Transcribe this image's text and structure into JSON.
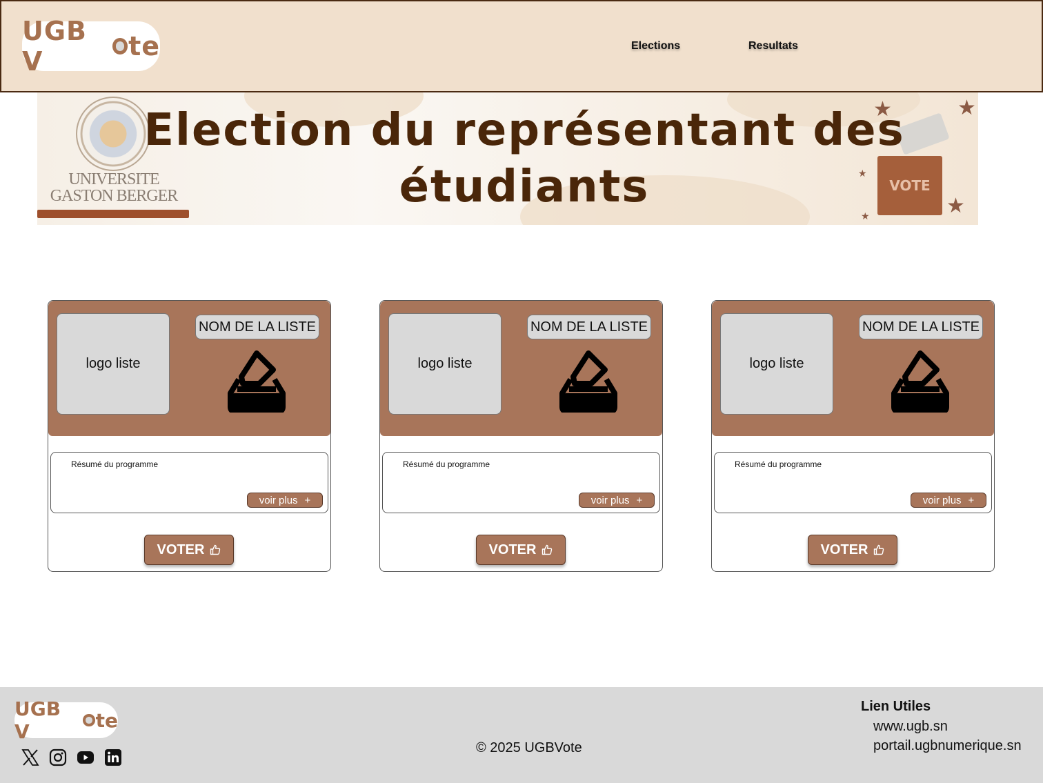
{
  "header": {
    "logo_prefix": "UGB V",
    "logo_suffix": "te",
    "nav": [
      "Elections",
      "Resultats"
    ]
  },
  "banner": {
    "title_line1": "Election du représentant des",
    "title_line2": "étudiants",
    "university_line1": "UNIVERSITE",
    "university_line2": "GASTON BERGER",
    "ballot_box_label": "VOTE"
  },
  "cards": [
    {
      "logo": "logo liste",
      "name": "NOM DE LA LISTE",
      "summary": "Résumé du programme",
      "more": "voir plus",
      "vote": "VOTER"
    },
    {
      "logo": "logo liste",
      "name": "NOM DE LA LISTE",
      "summary": "Résumé du programme",
      "more": "voir plus",
      "vote": "VOTER"
    },
    {
      "logo": "logo liste",
      "name": "NOM DE LA LISTE",
      "summary": "Résumé du programme",
      "more": "voir plus",
      "vote": "VOTER"
    }
  ],
  "footer": {
    "logo_prefix": "UGB V",
    "logo_suffix": "te",
    "social_icons": [
      "x-icon",
      "instagram-icon",
      "youtube-icon",
      "linkedin-icon"
    ],
    "copyright": "© 2025 UGBVote",
    "links_title": "Lien Utiles",
    "links": [
      "www.ugb.sn",
      "portail.ugbnumerique.sn"
    ]
  },
  "colors": {
    "header_bg": "#f1e0cd",
    "brand_brown": "#a8755a",
    "title_brown": "#4a2609",
    "footer_bg": "#d9d9d9"
  }
}
